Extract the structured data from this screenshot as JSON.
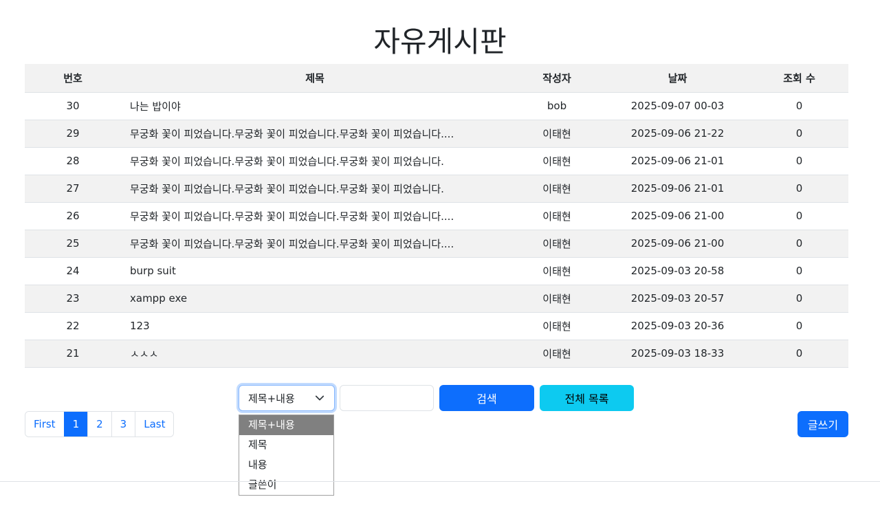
{
  "page": {
    "title": "자유게시판"
  },
  "table": {
    "headers": [
      "번호",
      "제목",
      "작성자",
      "날짜",
      "조회 수"
    ],
    "rows": [
      [
        "30",
        "나는 밥이야",
        "bob",
        "2025-09-07 00-03",
        "0"
      ],
      [
        "29",
        "무궁화 꽃이 피었습니다.무궁화 꽃이 피었습니다.무궁화 꽃이 피었습니다....",
        "이태현",
        "2025-09-06 21-22",
        "0"
      ],
      [
        "28",
        "무궁화 꽃이 피었습니다.무궁화 꽃이 피었습니다.무궁화 꽃이 피었습니다.",
        "이태현",
        "2025-09-06 21-01",
        "0"
      ],
      [
        "27",
        "무궁화 꽃이 피었습니다.무궁화 꽃이 피었습니다.무궁화 꽃이 피었습니다.",
        "이태현",
        "2025-09-06 21-01",
        "0"
      ],
      [
        "26",
        "무궁화 꽃이 피었습니다.무궁화 꽃이 피었습니다.무궁화 꽃이 피었습니다....",
        "이태현",
        "2025-09-06 21-00",
        "0"
      ],
      [
        "25",
        "무궁화 꽃이 피었습니다.무궁화 꽃이 피었습니다.무궁화 꽃이 피었습니다....",
        "이태현",
        "2025-09-06 21-00",
        "0"
      ],
      [
        "24",
        "burp suit",
        "이태현",
        "2025-09-03 20-58",
        "0"
      ],
      [
        "23",
        "xampp exe",
        "이태현",
        "2025-09-03 20-57",
        "0"
      ],
      [
        "22",
        "123",
        "이태현",
        "2025-09-03 20-36",
        "0"
      ],
      [
        "21",
        "ㅅㅅㅅ",
        "이태현",
        "2025-09-03 18-33",
        "0"
      ]
    ]
  },
  "search": {
    "select_value": "제목+내용",
    "options": [
      "제목+내용",
      "제목",
      "내용",
      "글쓴이"
    ],
    "input_value": "",
    "search_button": "검색",
    "all_button": "전체 목록"
  },
  "pagination": {
    "first": "First",
    "pages": [
      "1",
      "2",
      "3"
    ],
    "active": "1",
    "last": "Last"
  },
  "write_button": "글쓰기",
  "colors": {
    "primary": "#0d6efd",
    "info": "#0dcaf0",
    "stripe": "#f2f2f2",
    "option_highlight": "#808080"
  }
}
